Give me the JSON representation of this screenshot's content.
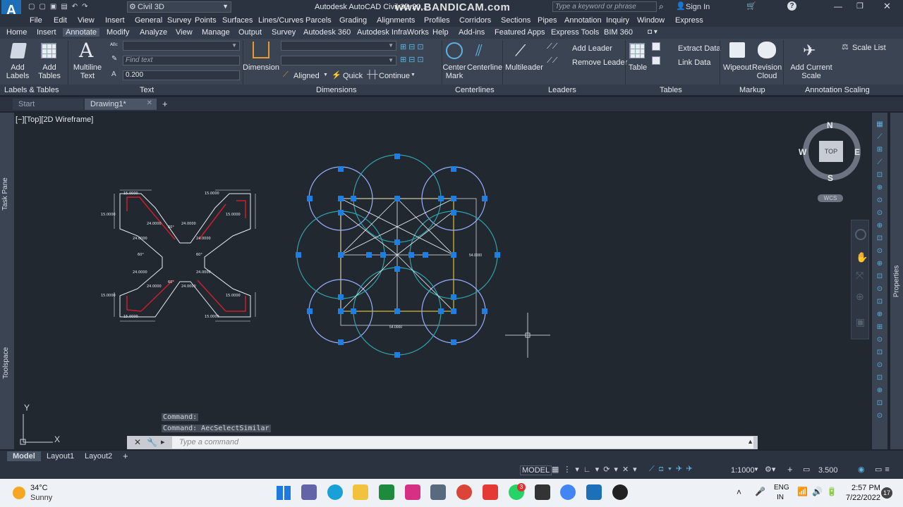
{
  "titlebar": {
    "app_name": "Civil 3D",
    "window_title": "Autodesk AutoCAD Civil 3D 20...",
    "watermark": "www.BANDICAM.com",
    "search_placeholder": "Type a keyword or phrase",
    "sign_in": "Sign In"
  },
  "menu": [
    "File",
    "Edit",
    "View",
    "Insert",
    "General",
    "Survey",
    "Points",
    "Surfaces",
    "Lines/Curves",
    "Parcels",
    "Grading",
    "Alignments",
    "Profiles",
    "Corridors",
    "Sections",
    "Pipes",
    "Annotation",
    "Inquiry",
    "Window",
    "Express"
  ],
  "ribbon_tabs": [
    "Home",
    "Insert",
    "Annotate",
    "Modify",
    "Analyze",
    "View",
    "Manage",
    "Output",
    "Survey",
    "Autodesk 360",
    "Autodesk InfraWorks",
    "Help",
    "Add-ins",
    "Featured Apps",
    "Express Tools",
    "BIM 360"
  ],
  "ribbon_active_tab": "Annotate",
  "ribbon": {
    "add_labels": "Add Labels",
    "add_tables": "Add Tables",
    "multiline_text": "Multiline Text",
    "find_text_placeholder": "Find text",
    "text_height": "0.200",
    "dimension": "Dimension",
    "aligned": "Aligned",
    "quick": "Quick",
    "continue": "Continue",
    "center_mark": "Center Mark",
    "centerline": "Centerline",
    "multileader": "Multileader",
    "add_leader": "Add Leader",
    "remove_leader": "Remove Leader",
    "table": "Table",
    "extract_data": "Extract Data",
    "link_data": "Link Data",
    "wipeout": "Wipeout",
    "revision_cloud": "Revision Cloud",
    "add_current_scale": "Add Current Scale",
    "scale_list": "Scale List",
    "panels": [
      "Labels & Tables",
      "Text",
      "Dimensions",
      "Centerlines",
      "Leaders",
      "Tables",
      "Markup",
      "Annotation Scaling"
    ]
  },
  "doc_tabs": {
    "start": "Start",
    "drawing": "Drawing1*"
  },
  "viewport": {
    "label": "[−][Top][2D Wireframe]",
    "left_panel_1": "Task Pane",
    "left_panel_2": "Toolspace",
    "right_panel": "Properties",
    "compass": {
      "n": "N",
      "s": "S",
      "e": "E",
      "w": "W",
      "top": "TOP",
      "wcs": "WCS"
    },
    "ucs_x": "X",
    "ucs_y": "Y",
    "dims_left": [
      "15.0000",
      "15.0000",
      "15.0000",
      "15.0000",
      "15.0000",
      "15.0000",
      "15.0000",
      "15.0000",
      "24.0000",
      "24.0000",
      "24.0000",
      "24.0000",
      "24.0000",
      "24.0000",
      "24.0000",
      "24.0000",
      "60°",
      "60°",
      "60°",
      "60°"
    ],
    "dim_right_1": "54.0000",
    "dim_right_2": "54.0000"
  },
  "command": {
    "line1": "Command:",
    "line2": "Command: AecSelectSimilar",
    "placeholder": "Type a command"
  },
  "layout_tabs": [
    "Model",
    "Layout1",
    "Layout2"
  ],
  "status": {
    "model": "MODEL",
    "scale": "1:1000",
    "value": "3.500"
  },
  "taskbar": {
    "temp": "34°C",
    "weather": "Sunny",
    "lang1": "ENG",
    "lang2": "IN",
    "time": "2:57 PM",
    "date": "7/22/2022",
    "badge": "3",
    "notif": "17"
  }
}
